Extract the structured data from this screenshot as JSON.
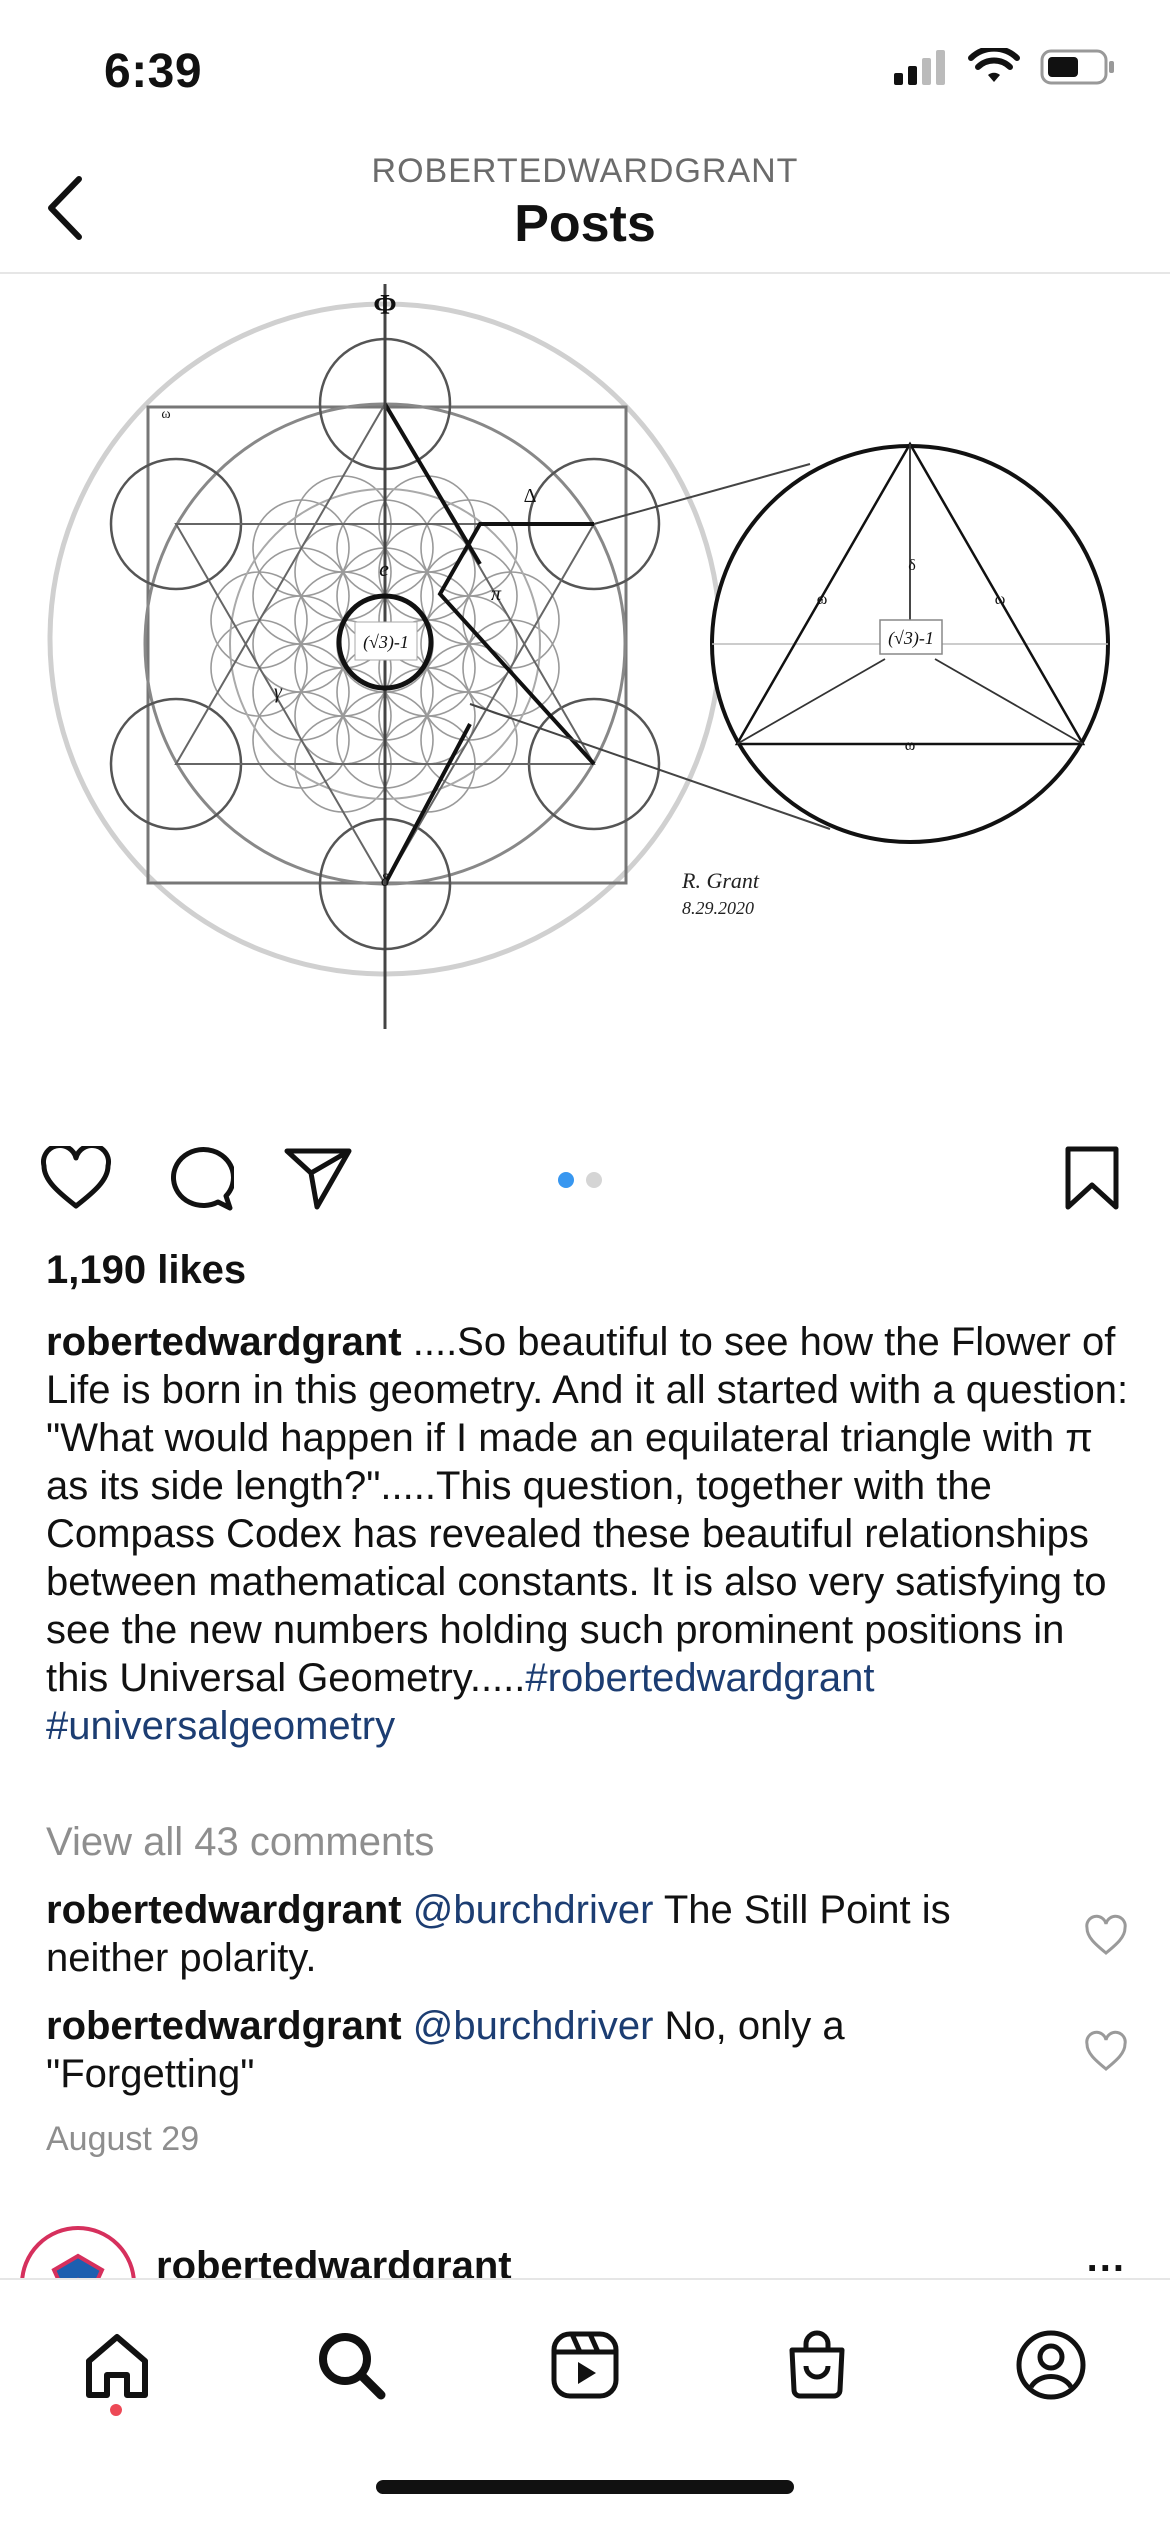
{
  "status": {
    "time": "6:39"
  },
  "header": {
    "username": "ROBERTEDWARDGRANT",
    "title": "Posts"
  },
  "image": {
    "labels": {
      "phi": "Φ",
      "center_box": "(√3)-1",
      "detail_box": "(√3)-1",
      "e": "e",
      "pi": "π",
      "gamma": "γ",
      "delta": "δ",
      "delta_cap": "Δ",
      "omega": "ω",
      "signature_name": "R. Grant",
      "signature_date": "8.29.2020"
    }
  },
  "post": {
    "likes": "1,190 likes",
    "caption": {
      "username": "robertedwardgrant",
      "text": " ....So beautiful to see how the Flower of Life is born in this geometry.  And it all started with a question: \"What would happen if I made an equilateral triangle with π as its side length?\".....This question, together with the Compass Codex has revealed these beautiful relationships between mathematical constants.  It is also very satisfying to see the new numbers holding such prominent positions in this Universal Geometry.....",
      "hashtag1": "#robertedwardgrant",
      "hashtag2": "#universalgeometry"
    },
    "view_all_comments": "View all 43 comments",
    "comments": [
      {
        "username": "robertedwardgrant",
        "mention": "@burchdriver",
        "text": " The Still Point is neither polarity."
      },
      {
        "username": "robertedwardgrant",
        "mention": "@burchdriver",
        "text": " No, only a \"Forgetting\""
      }
    ],
    "date": "August 29",
    "carousel": {
      "count": 2,
      "active": 1
    }
  },
  "next_post": {
    "username": "robertedwardgrant",
    "more": "..."
  },
  "tabbar": {
    "items": [
      "home-icon",
      "search-icon",
      "reels-icon",
      "shop-icon",
      "profile-icon"
    ]
  },
  "colors": {
    "link": "#1c3d72",
    "muted": "#8e8e8e",
    "dot_active": "#3897f0",
    "notify": "#ed4956"
  }
}
